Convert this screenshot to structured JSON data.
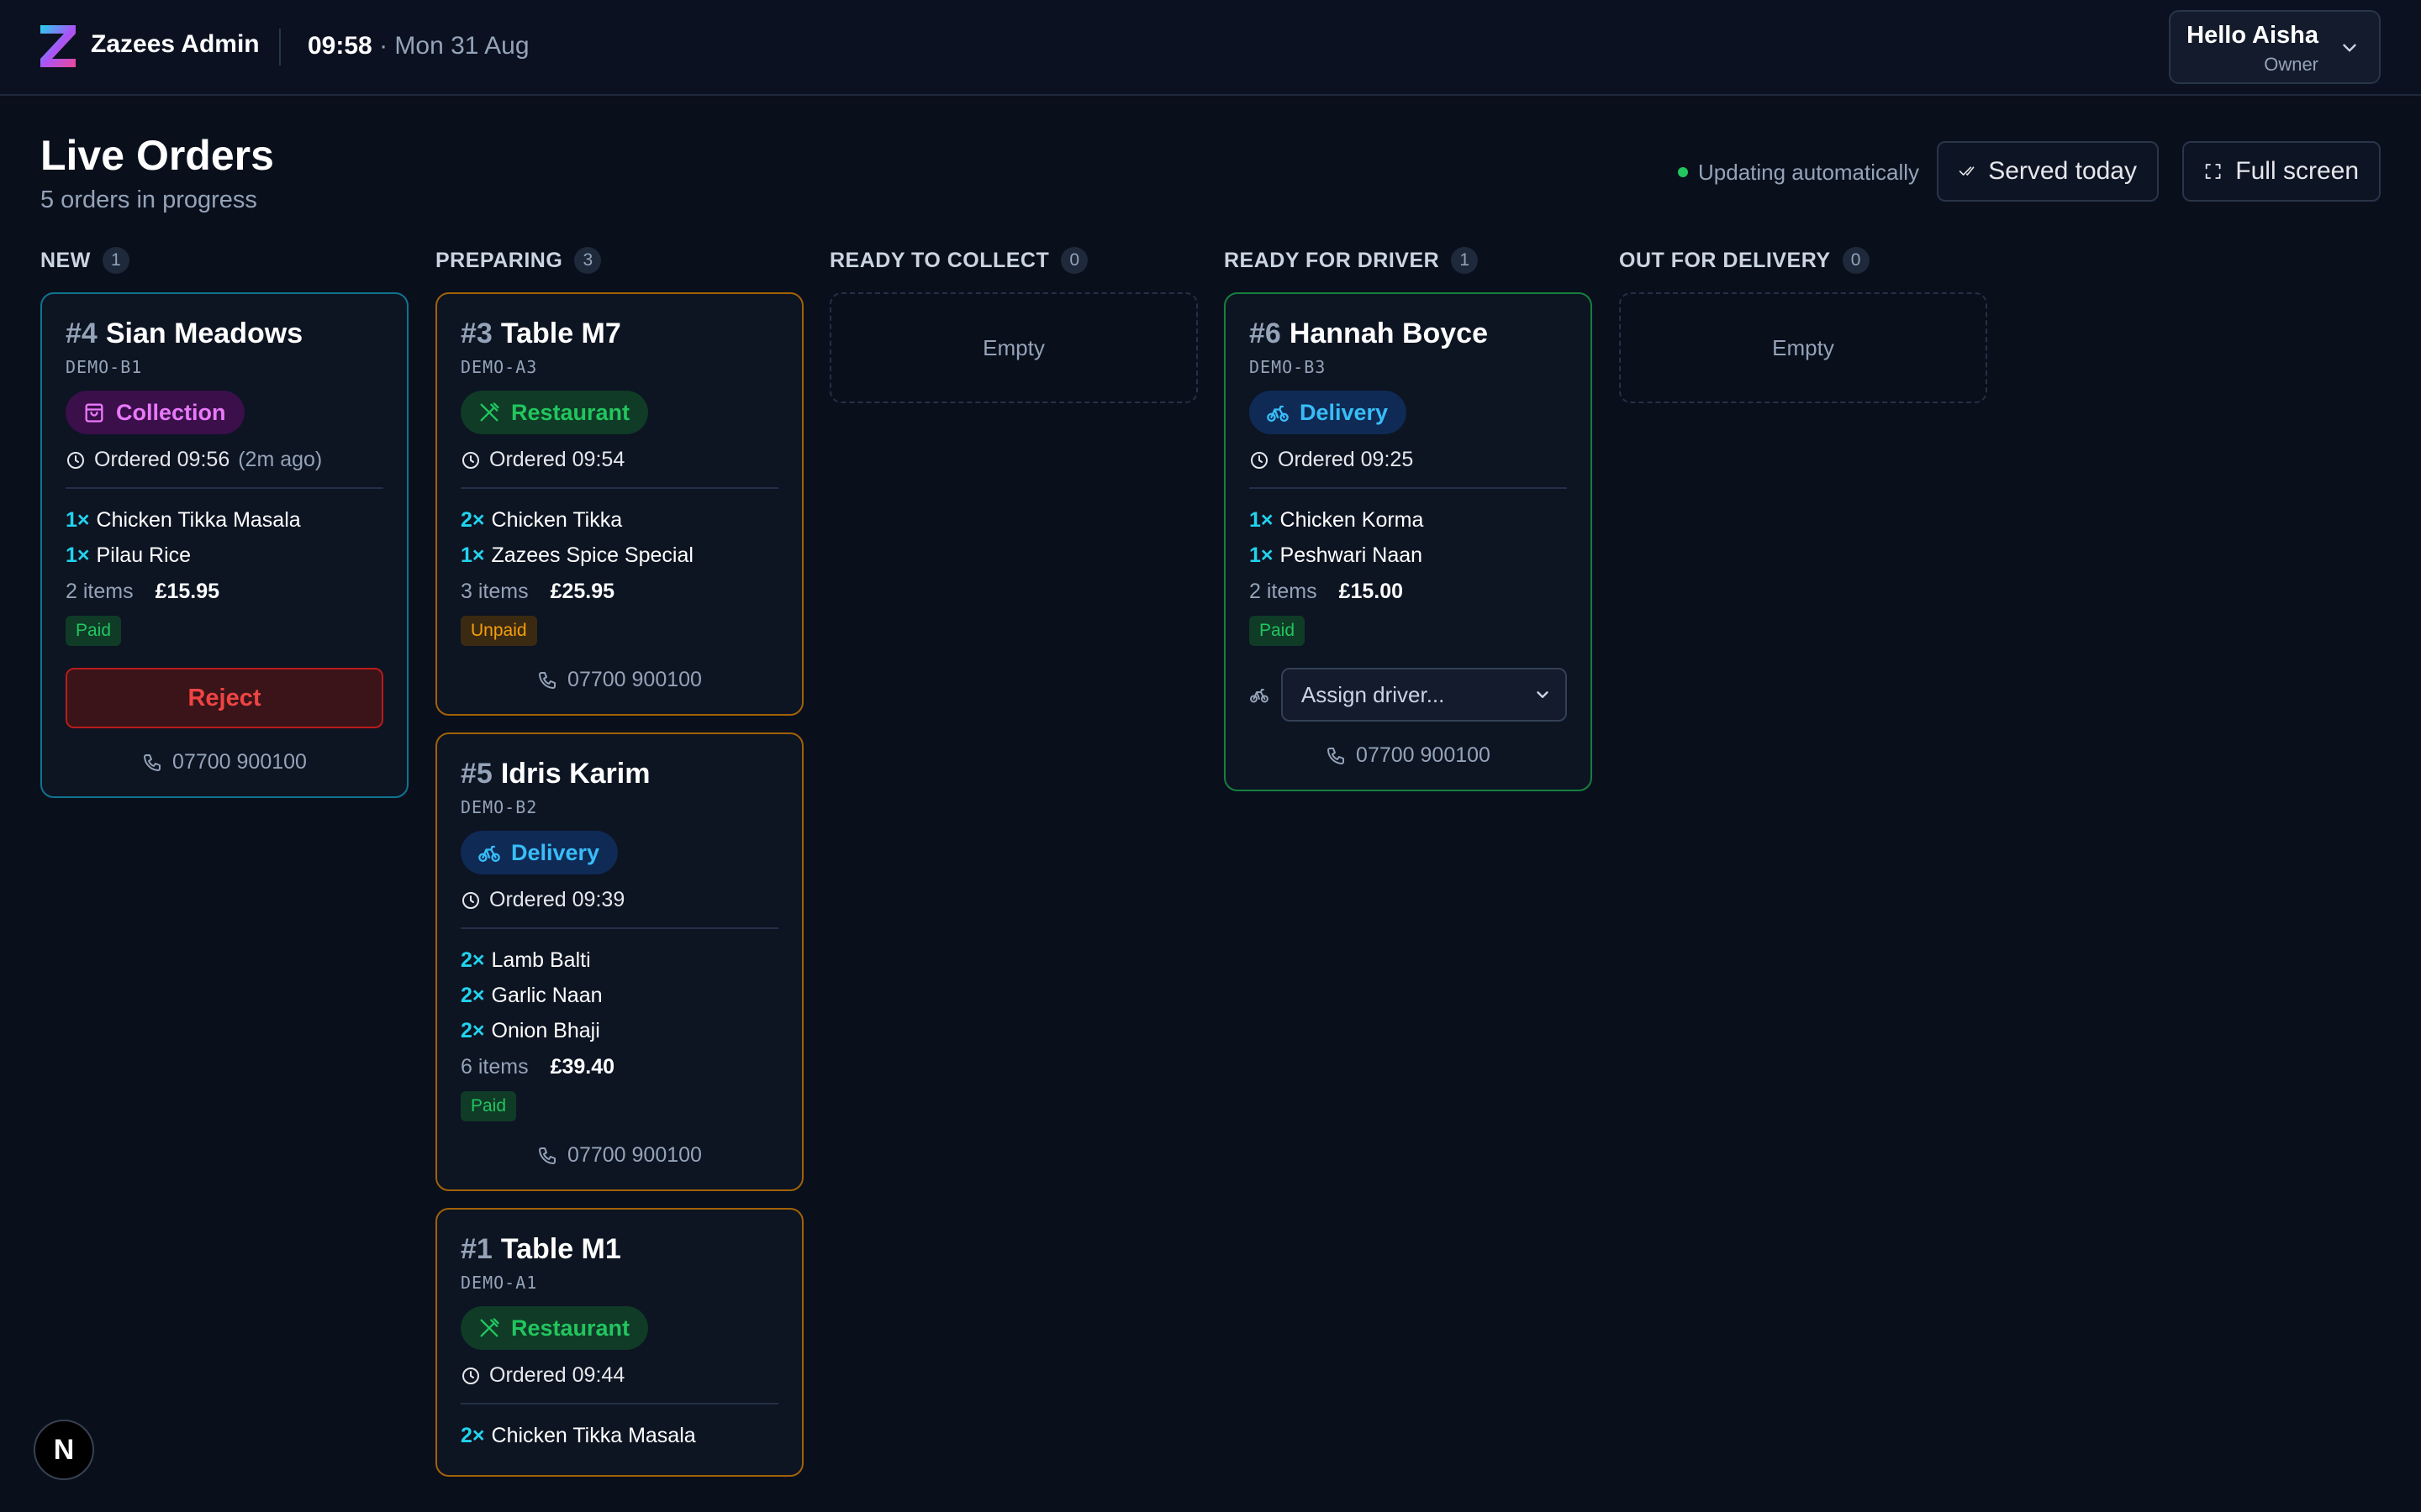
{
  "app": {
    "name": "Zazees Admin"
  },
  "clock": {
    "time": "09:58",
    "date": " · Mon 31 Aug"
  },
  "user": {
    "greeting": "Hello Aisha",
    "role": "Owner"
  },
  "page": {
    "title": "Live Orders",
    "subtitle": "5 orders in progress",
    "live_status": "Updating automatically",
    "served_today_label": "Served today",
    "full_screen_label": "Full screen"
  },
  "columns": [
    {
      "title": "NEW",
      "count": "1"
    },
    {
      "title": "PREPARING",
      "count": "3"
    },
    {
      "title": "READY TO COLLECT",
      "count": "0",
      "empty_label": "Empty"
    },
    {
      "title": "READY FOR DRIVER",
      "count": "1"
    },
    {
      "title": "OUT FOR DELIVERY",
      "count": "0",
      "empty_label": "Empty"
    }
  ],
  "orders": {
    "o4": {
      "number": "#4",
      "name": "Sian Meadows",
      "code": "DEMO-B1",
      "type": "Collection",
      "ordered": "Ordered 09:56",
      "ago": "(2m ago)",
      "items": [
        {
          "qty": "1×",
          "name": "Chicken Tikka Masala"
        },
        {
          "qty": "1×",
          "name": "Pilau Rice"
        }
      ],
      "item_count": "2 items",
      "total": "£15.95",
      "payment": "Paid",
      "reject_label": "Reject",
      "phone": "07700 900100"
    },
    "o3": {
      "number": "#3",
      "name": "Table M7",
      "code": "DEMO-A3",
      "type": "Restaurant",
      "ordered": "Ordered 09:54",
      "items": [
        {
          "qty": "2×",
          "name": "Chicken Tikka"
        },
        {
          "qty": "1×",
          "name": "Zazees Spice Special"
        }
      ],
      "item_count": "3 items",
      "total": "£25.95",
      "payment": "Unpaid",
      "phone": "07700 900100"
    },
    "o5": {
      "number": "#5",
      "name": "Idris Karim",
      "code": "DEMO-B2",
      "type": "Delivery",
      "ordered": "Ordered 09:39",
      "items": [
        {
          "qty": "2×",
          "name": "Lamb Balti"
        },
        {
          "qty": "2×",
          "name": "Garlic Naan"
        },
        {
          "qty": "2×",
          "name": "Onion Bhaji"
        }
      ],
      "item_count": "6 items",
      "total": "£39.40",
      "payment": "Paid",
      "phone": "07700 900100"
    },
    "o1": {
      "number": "#1",
      "name": "Table M1",
      "code": "DEMO-A1",
      "type": "Restaurant",
      "ordered": "Ordered 09:44",
      "items": [
        {
          "qty": "2×",
          "name": "Chicken Tikka Masala"
        }
      ]
    },
    "o6": {
      "number": "#6",
      "name": "Hannah Boyce",
      "code": "DEMO-B3",
      "type": "Delivery",
      "ordered": "Ordered 09:25",
      "items": [
        {
          "qty": "1×",
          "name": "Chicken Korma"
        },
        {
          "qty": "1×",
          "name": "Peshwari Naan"
        }
      ],
      "item_count": "2 items",
      "total": "£15.00",
      "payment": "Paid",
      "assign_placeholder": "Assign driver...",
      "phone": "07700 900100"
    }
  },
  "dev_badge": "N",
  "colors": {
    "background": "#0a0f1c",
    "new_border": "#0e7490",
    "preparing_border": "#a16207",
    "ready_border": "#15803d",
    "qty_accent": "#22d3ee",
    "reject": "#ef4444",
    "live_dot": "#22c55e"
  },
  "icons": [
    "logo-z-icon",
    "chevron-down-icon",
    "double-check-icon",
    "fullscreen-icon",
    "bag-icon",
    "utensils-icon",
    "bike-icon",
    "clock-icon",
    "phone-icon"
  ]
}
